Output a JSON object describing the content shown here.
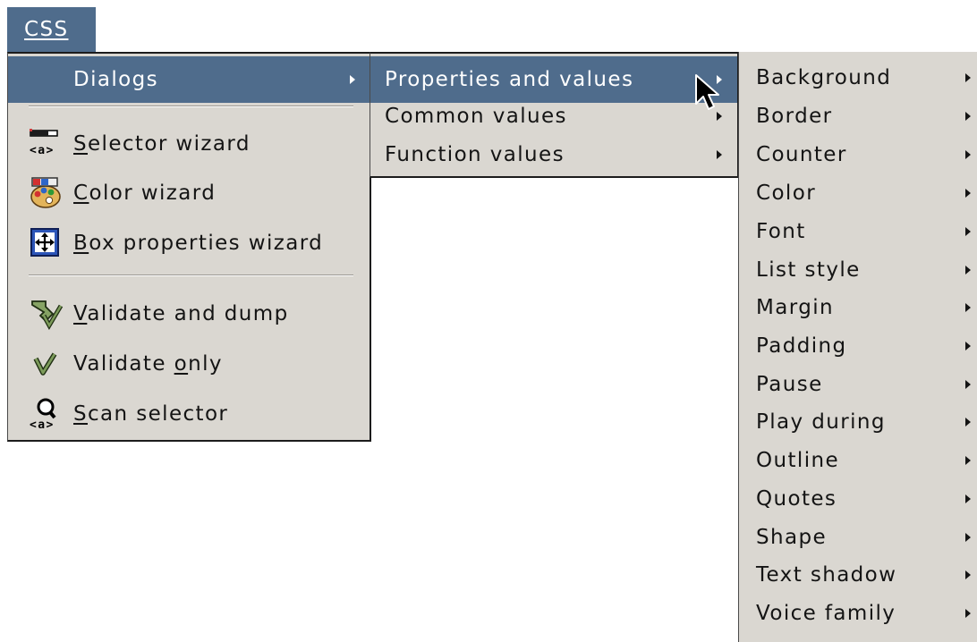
{
  "menubar": {
    "css_label": "CSS"
  },
  "css_menu": {
    "dialogs_label": "Dialogs",
    "items": [
      {
        "label": "Selector wizard",
        "mnemonic": "S",
        "rest": "elector wizard",
        "icon": "selector-tag-icon"
      },
      {
        "label": "Color wizard",
        "mnemonic": "C",
        "rest": "olor wizard",
        "icon": "color-palette-icon"
      },
      {
        "label": "Box properties wizard",
        "mnemonic": "B",
        "rest": "ox properties wizard",
        "icon": "box-move-icon"
      },
      {
        "label": "Validate and dump",
        "mnemonic": "V",
        "rest": "alidate and dump",
        "icon": "validate-dump-icon"
      },
      {
        "label": "Validate only",
        "pre": "Validate ",
        "mnemonic": "o",
        "rest": "nly",
        "icon": "checkmark-icon"
      },
      {
        "label": "Scan selector",
        "mnemonic": "S",
        "rest": "can selector",
        "icon": "scan-magnifier-icon"
      }
    ]
  },
  "dialogs_menu": {
    "items": [
      "Properties and values",
      "Common values",
      "Function values"
    ]
  },
  "properties_menu": {
    "items": [
      "Background",
      "Border",
      "Counter",
      "Color",
      "Font",
      "List style",
      "Margin",
      "Padding",
      "Pause",
      "Play during",
      "Outline",
      "Quotes",
      "Shape",
      "Text shadow",
      "Voice family"
    ]
  },
  "colors": {
    "highlight": "#4f6c8c",
    "menu_bg": "#dad7d1"
  }
}
